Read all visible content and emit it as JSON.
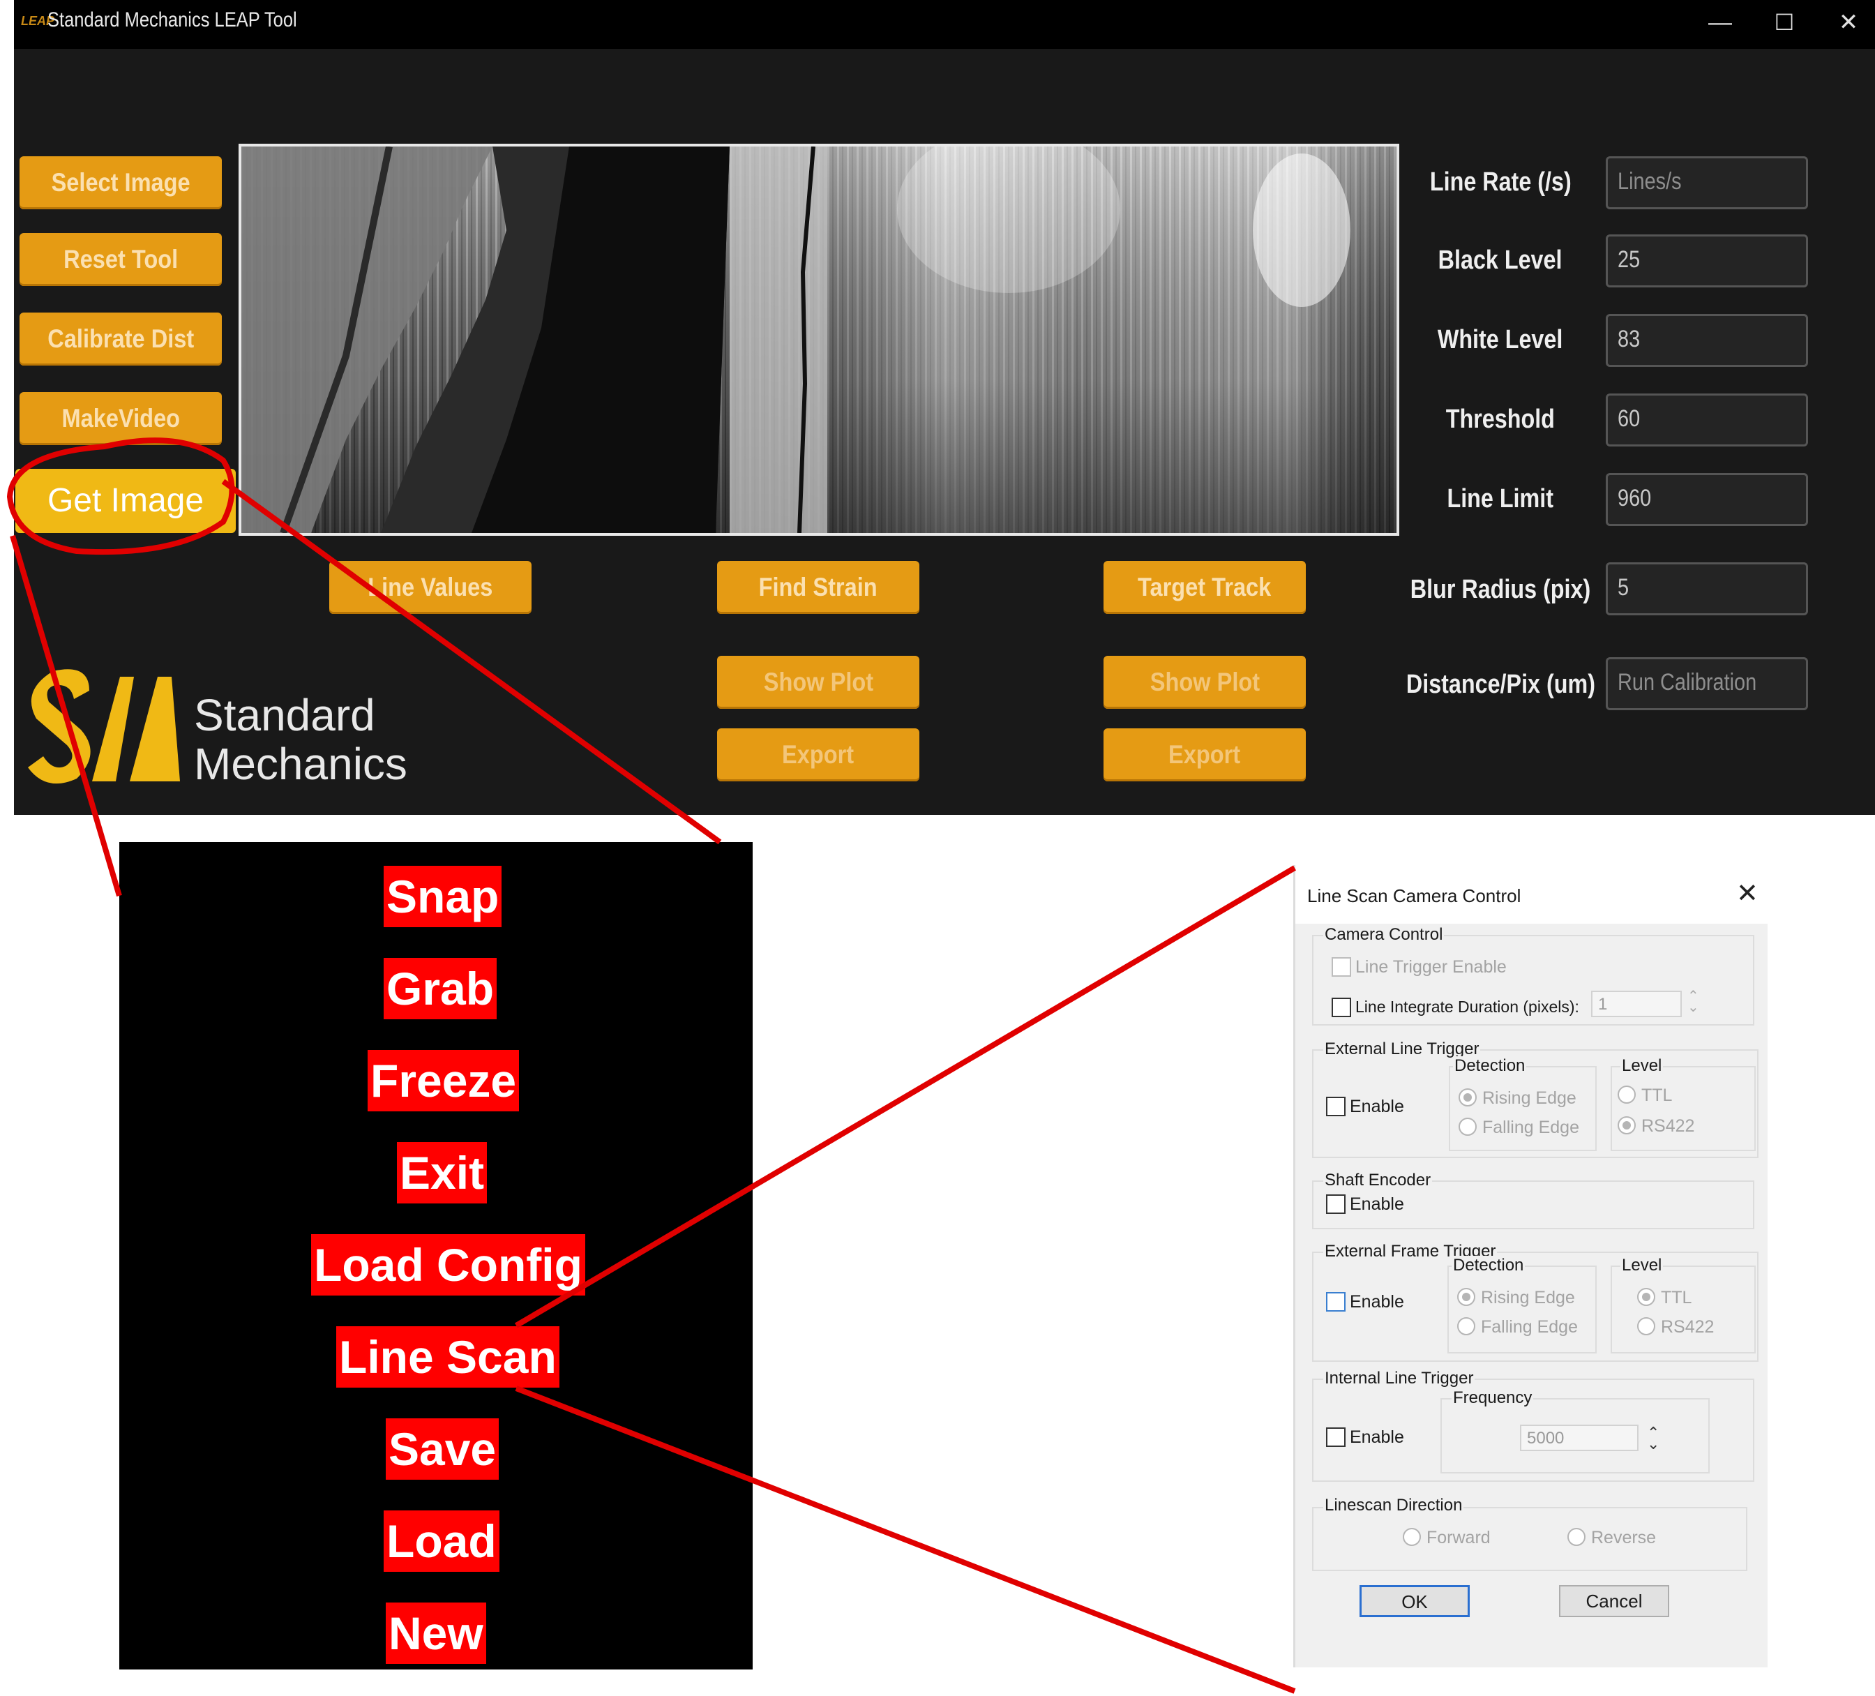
{
  "window": {
    "logo_text": "LEAP",
    "title": "Standard Mechanics LEAP Tool",
    "minimize": "—",
    "maximize": "☐",
    "close": "✕"
  },
  "left_buttons": [
    "Select Image",
    "Reset Tool",
    "Calibrate Dist",
    "MakeVideo"
  ],
  "get_image": "Get Image",
  "action_buttons": {
    "line_values": "Line Values",
    "find_strain": "Find Strain",
    "target_track": "Target Track",
    "show_plot_1": "Show Plot",
    "export_1": "Export",
    "show_plot_2": "Show Plot",
    "export_2": "Export"
  },
  "fields": [
    {
      "label": "Line Rate (/s)",
      "value": "Lines/s"
    },
    {
      "label": "Black Level",
      "value": "25"
    },
    {
      "label": "White Level",
      "value": "83"
    },
    {
      "label": "Threshold",
      "value": "60"
    },
    {
      "label": "Line Limit",
      "value": "960"
    },
    {
      "label": "Blur Radius (pix)",
      "value": "5"
    },
    {
      "label": "Distance/Pix (um)",
      "value": "Run Calibration"
    }
  ],
  "logo": {
    "line1": "Standard",
    "line2": "Mechanics"
  },
  "menu_items": [
    "Snap",
    "Grab",
    "Freeze",
    "Exit",
    "Load Config",
    "Line Scan",
    "Save",
    "Load",
    "New"
  ],
  "dialog": {
    "title": "Line Scan Camera Control",
    "close": "✕",
    "camera_control": {
      "title": "Camera Control",
      "line_trigger_enable": "Line Trigger Enable",
      "line_integrate": "Line Integrate Duration (pixels):",
      "line_integrate_value": "1"
    },
    "external_line_trigger": {
      "title": "External Line Trigger",
      "enable": "Enable",
      "detection": "Detection",
      "rising": "Rising Edge",
      "falling": "Falling Edge",
      "level": "Level",
      "ttl": "TTL",
      "rs422": "RS422"
    },
    "shaft_encoder": {
      "title": "Shaft Encoder",
      "enable": "Enable"
    },
    "external_frame_trigger": {
      "title": "External Frame Trigger",
      "enable": "Enable",
      "detection": "Detection",
      "rising": "Rising Edge",
      "falling": "Falling Edge",
      "level": "Level",
      "ttl": "TTL",
      "rs422": "RS422"
    },
    "internal_line_trigger": {
      "title": "Internal Line Trigger",
      "enable": "Enable",
      "frequency": "Frequency",
      "frequency_value": "5000"
    },
    "linescan_direction": {
      "title": "Linescan Direction",
      "forward": "Forward",
      "reverse": "Reverse"
    },
    "ok": "OK",
    "cancel": "Cancel"
  },
  "colors": {
    "app_bg": "#191919",
    "button_orange": "#e59b14",
    "get_image_yellow": "#f0b915",
    "callout_red": "#e00000",
    "menu_item_red": "#ff0000"
  }
}
